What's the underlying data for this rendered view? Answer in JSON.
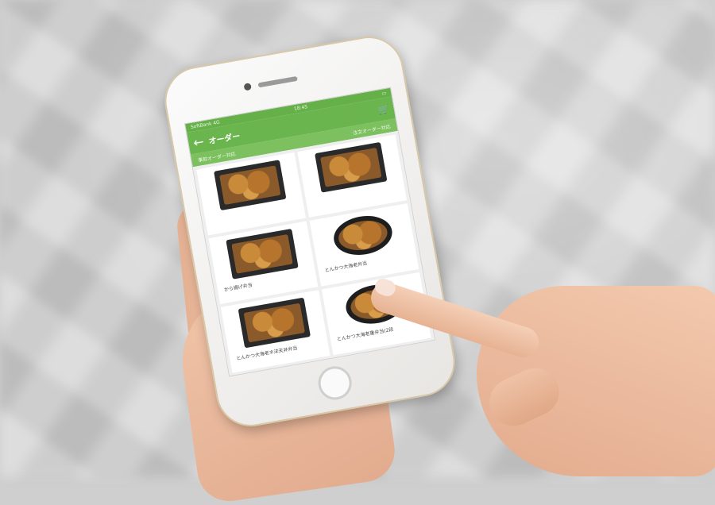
{
  "phone_app": {
    "status": {
      "carrier": "SoftBank 4G",
      "time": "18:45"
    },
    "header": {
      "title": "オーダー",
      "back_icon": "back-arrow-icon",
      "cart_icon": "cart-icon"
    },
    "subheader": {
      "left": "事前オーダー対応",
      "right": "注文オーダー対応"
    },
    "menu_items": [
      {
        "label": ""
      },
      {
        "label": ""
      },
      {
        "label": "から揚げ弁当"
      },
      {
        "label": "とんかつ大海老弁当"
      },
      {
        "label": "とんかつ大海老ネ洋天丼弁当"
      },
      {
        "label": "とんかつ大海老重弁当(2段"
      },
      {
        "label": ""
      },
      {
        "label": ""
      }
    ]
  },
  "colors": {
    "accent_green": "#6ab54d",
    "status_green": "#66b04a"
  }
}
